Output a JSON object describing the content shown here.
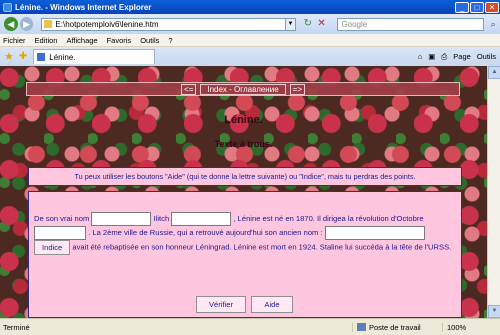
{
  "window": {
    "title": "Lénine. - Windows Internet Explorer",
    "min": "_",
    "max": "□",
    "close": "✕"
  },
  "address": {
    "back": "◀",
    "forward": "▶",
    "url": "E:\\hotpotemploiv6\\lenine.htm",
    "search_placeholder": "Google"
  },
  "menu": [
    "Fichier",
    "Edition",
    "Affichage",
    "Favoris",
    "Outils",
    "?"
  ],
  "tab": {
    "label": "Lénine."
  },
  "commands": {
    "page": "Page",
    "tools": "Outils"
  },
  "nav": {
    "prev": "<=",
    "index": "Index - Оглавление",
    "next": "=>"
  },
  "page": {
    "title": "Lénine.",
    "subtitle": "Texte à trous.",
    "instructions": "Tu peux utiliser les boutons \"Aide\" (qui te donne la lettre suivante) ou \"Indice\", mais tu perdras des points.",
    "t1": "De son vrai nom",
    "t2": "Ilitch",
    "t3": ", Lénine est né en 1870. Il dirigea la révolution d'Octobre",
    "t4": ". La 2ème ville de Russie, qui a retrouvé aujourd'hui son ancien nom :",
    "t5": "avait été rebaptisée en son honneur Léningrad. Lénine est mort en 1924. Staline lui succéda à la tête de l'URSS.",
    "indice": "Indice",
    "verifier": "Vérifier",
    "aide": "Aide"
  },
  "status": {
    "done": "Terminé",
    "zone": "Poste de travail",
    "zoom": "100%"
  }
}
